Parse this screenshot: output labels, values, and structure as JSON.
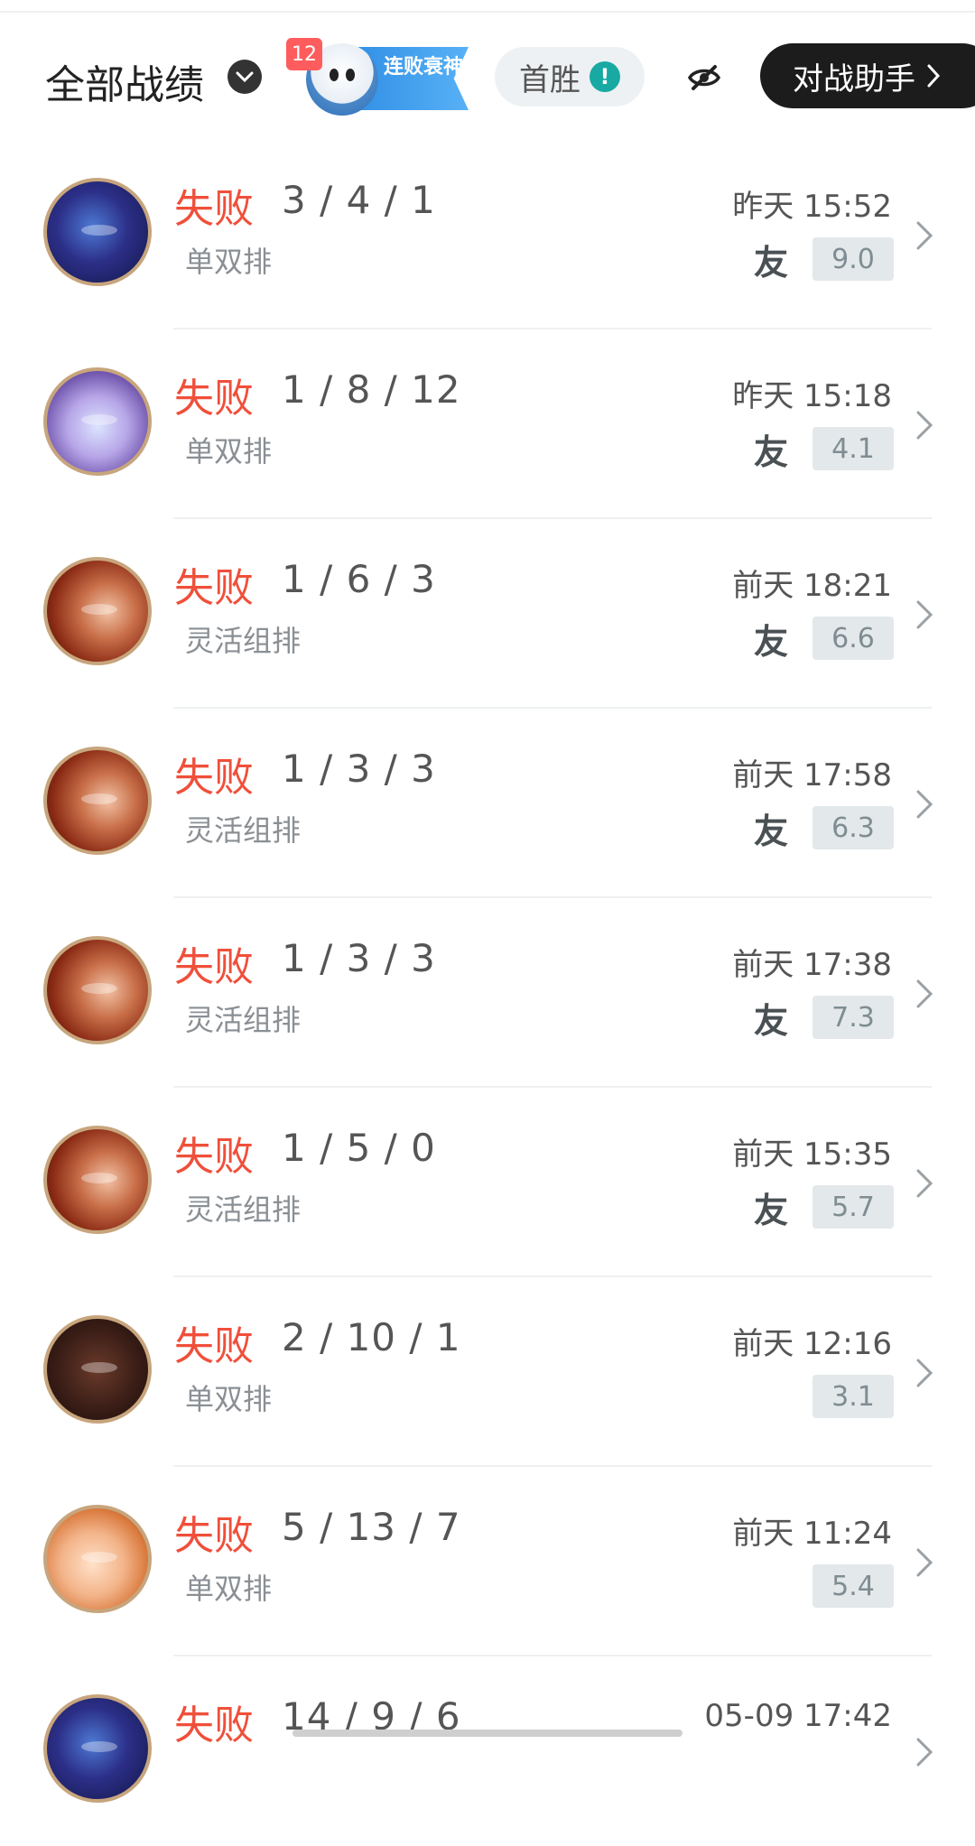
{
  "header": {
    "title": "全部战绩",
    "badge_count": "12",
    "badge_text": "连败衰神",
    "first_win_label": "首胜",
    "first_win_info": "!",
    "assistant_label": "对战助手"
  },
  "matches": [
    {
      "result": "失败",
      "kda": "3 / 4 / 1",
      "mode": "单双排",
      "time": "昨天 15:52",
      "friend": "友",
      "score": "9.0"
    },
    {
      "result": "失败",
      "kda": "1 / 8 / 12",
      "mode": "单双排",
      "time": "昨天 15:18",
      "friend": "友",
      "score": "4.1"
    },
    {
      "result": "失败",
      "kda": "1 / 6 / 3",
      "mode": "灵活组排",
      "time": "前天 18:21",
      "friend": "友",
      "score": "6.6"
    },
    {
      "result": "失败",
      "kda": "1 / 3 / 3",
      "mode": "灵活组排",
      "time": "前天 17:58",
      "friend": "友",
      "score": "6.3"
    },
    {
      "result": "失败",
      "kda": "1 / 3 / 3",
      "mode": "灵活组排",
      "time": "前天 17:38",
      "friend": "友",
      "score": "7.3"
    },
    {
      "result": "失败",
      "kda": "1 / 5 / 0",
      "mode": "灵活组排",
      "time": "前天 15:35",
      "friend": "友",
      "score": "5.7"
    },
    {
      "result": "失败",
      "kda": "2 / 10 / 1",
      "mode": "单双排",
      "time": "前天 12:16",
      "friend": "",
      "score": "3.1"
    },
    {
      "result": "失败",
      "kda": "5 / 13 / 7",
      "mode": "单双排",
      "time": "前天 11:24",
      "friend": "",
      "score": "5.4"
    },
    {
      "result": "失败",
      "kda": "14 / 9 / 6",
      "mode": "",
      "time": "05-09 17:42",
      "friend": "",
      "score": ""
    }
  ],
  "colors": {
    "loss": "#f04f3a",
    "accent_teal": "#19a9a3",
    "assistant_bg": "#1c1c1c"
  }
}
